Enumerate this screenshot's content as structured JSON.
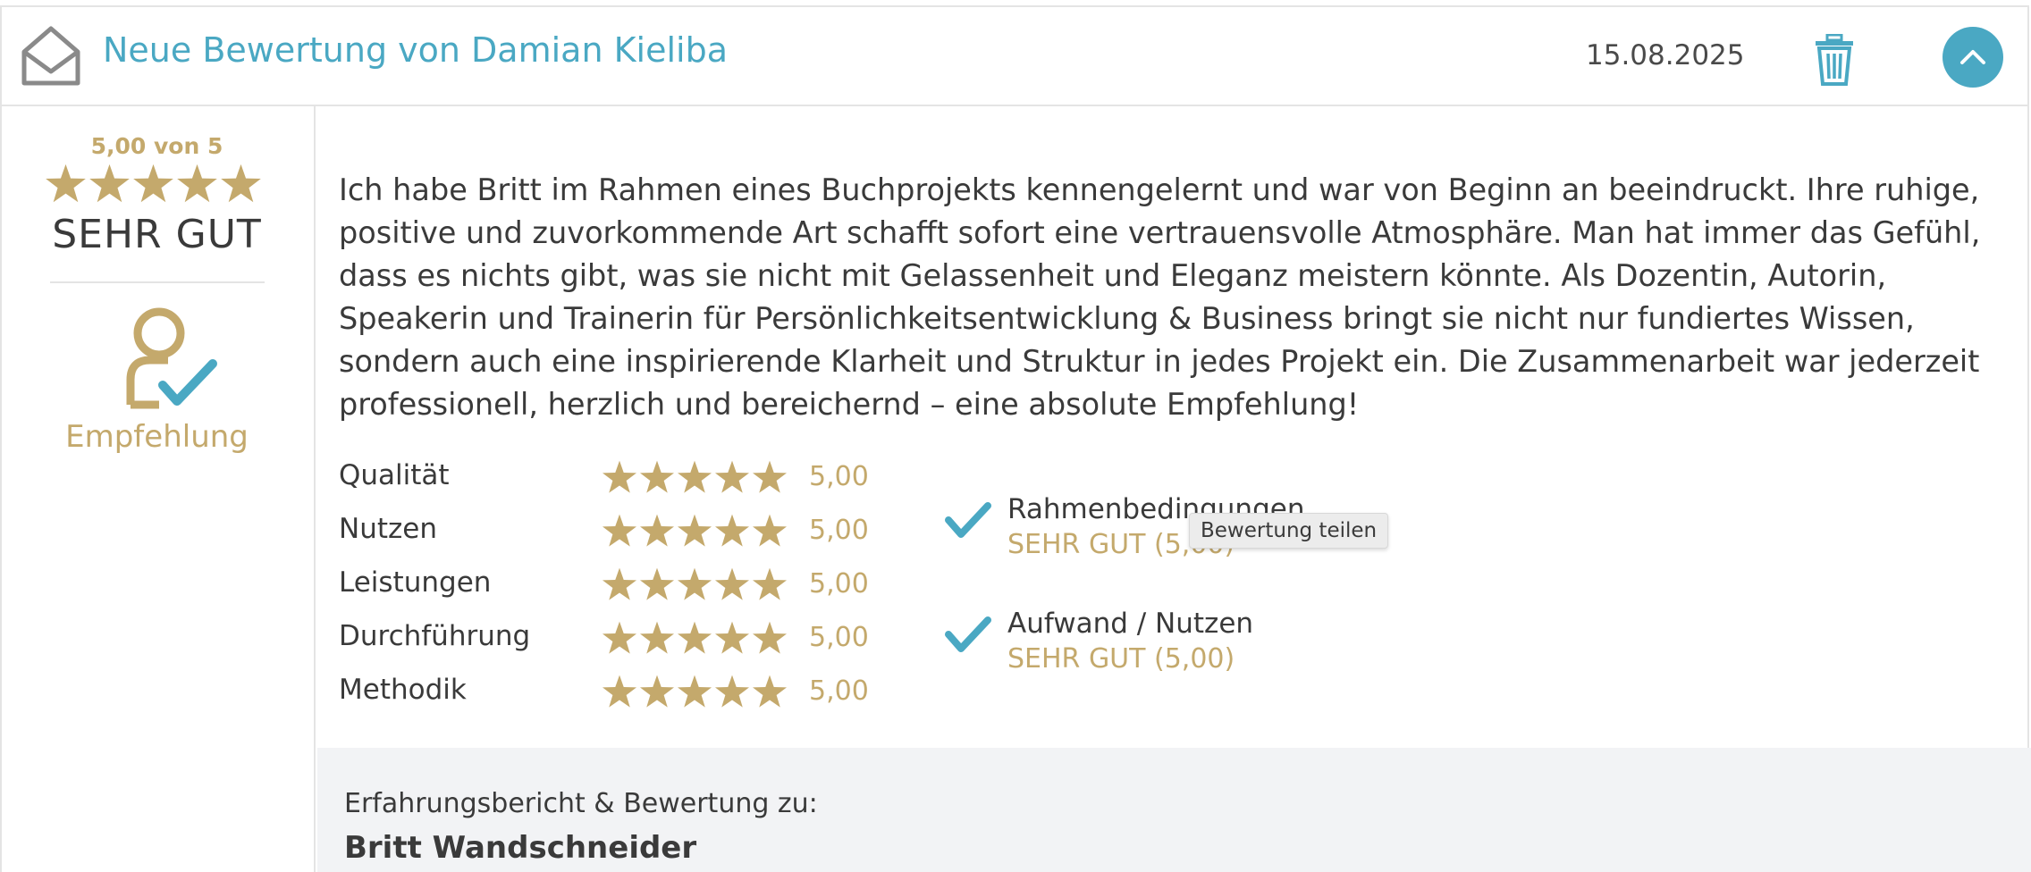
{
  "header": {
    "title": "Neue Bewertung von Damian Kieliba",
    "date": "15.08.2025"
  },
  "overall": {
    "score_text": "5,00 von 5",
    "stars": 5,
    "label": "SEHR GUT",
    "recommendation": "Empfehlung"
  },
  "review": {
    "text": "Ich habe Britt im Rahmen eines Buchprojekts kennengelernt und war von Beginn an beeindruckt. Ihre ruhige, positive und zuvorkommende Art schafft sofort eine vertrauensvolle Atmosphäre. Man hat immer das Gefühl, dass es nichts gibt, was sie nicht mit Gelassenheit und Eleganz meistern könnte. Als Dozentin, Autorin, Speakerin und Trainerin für Persönlichkeitsentwicklung & Business bringt sie nicht nur fundiertes Wissen, sondern auch eine inspirierende Klarheit und Struktur in jedes Projekt ein. Die Zusammenarbeit war jederzeit professionell, herzlich und bereichernd – eine absolute Empfehlung!"
  },
  "criteria": [
    {
      "name": "Qualität",
      "stars": 5,
      "value": "5,00"
    },
    {
      "name": "Nutzen",
      "stars": 5,
      "value": "5,00"
    },
    {
      "name": "Leistungen",
      "stars": 5,
      "value": "5,00"
    },
    {
      "name": "Durchführung",
      "stars": 5,
      "value": "5,00"
    },
    {
      "name": "Methodik",
      "stars": 5,
      "value": "5,00"
    }
  ],
  "conditions": [
    {
      "name": "Rahmenbedingungen",
      "value": "SEHR GUT (5,00)"
    },
    {
      "name": "Aufwand / Nutzen",
      "value": "SEHR GUT (5,00)"
    }
  ],
  "tooltip": "Bewertung teilen",
  "footer": {
    "label": "Erfahrungsbericht & Bewertung zu:",
    "name": "Britt Wandschneider"
  },
  "colors": {
    "accent": "#4aa8c3",
    "gold": "#c4a96c",
    "text": "#3a3a3a",
    "border": "#e4e4e4",
    "footer_bg": "#f2f3f5"
  }
}
